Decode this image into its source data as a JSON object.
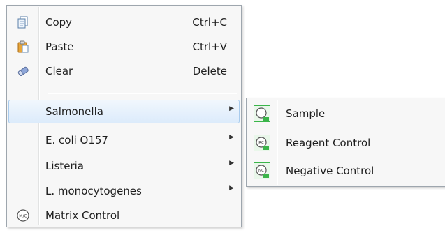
{
  "menu": {
    "items": [
      {
        "label": "Copy",
        "shortcut": "Ctrl+C",
        "icon": "copy-icon"
      },
      {
        "label": "Paste",
        "shortcut": "Ctrl+V",
        "icon": "paste-icon"
      },
      {
        "label": "Clear",
        "shortcut": "Delete",
        "icon": "eraser-icon"
      },
      {
        "label": "Salmonella",
        "submenu": true
      },
      {
        "label": "E. coli O157",
        "submenu": true
      },
      {
        "label": "Listeria",
        "submenu": true
      },
      {
        "label": "L. monocytogenes",
        "submenu": true
      },
      {
        "label": "Matrix Control",
        "icon": "matrix-control-icon",
        "icon_text": "M/C"
      }
    ]
  },
  "submenu": {
    "items": [
      {
        "label": "Sample",
        "icon": "sample-icon"
      },
      {
        "label": "Reagent Control",
        "icon": "reagent-control-icon",
        "icon_text": "RC"
      },
      {
        "label": "Negative Control",
        "icon": "negative-control-icon",
        "icon_text": "NC"
      }
    ]
  },
  "colors": {
    "highlight_border": "#a8cbed",
    "highlight_fill": "#dcebfb",
    "icon_green": "#3bb54a"
  }
}
